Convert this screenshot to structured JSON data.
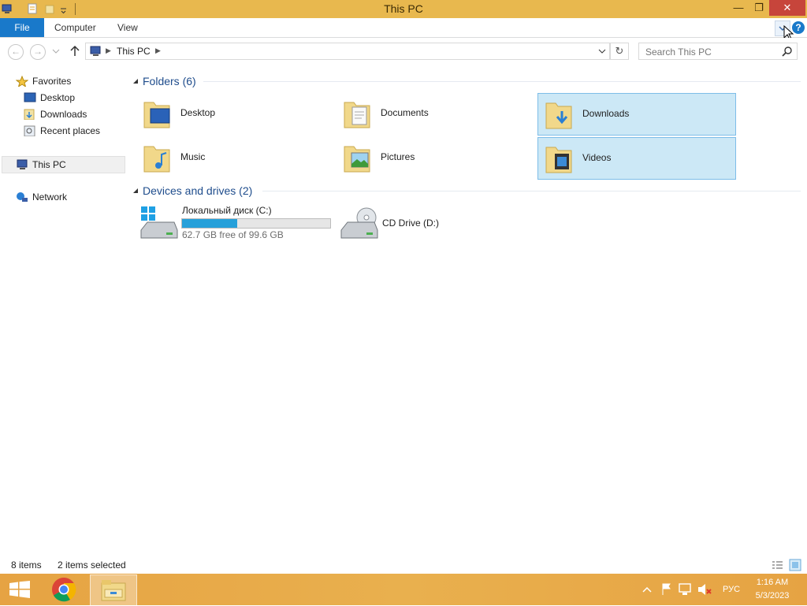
{
  "window": {
    "title": "This PC"
  },
  "ribbon": {
    "tabs": [
      "File",
      "Computer",
      "View"
    ]
  },
  "address": {
    "crumbs": [
      "This PC"
    ]
  },
  "search": {
    "placeholder": "Search This PC"
  },
  "navpane": {
    "favorites": "Favorites",
    "fav_items": [
      "Desktop",
      "Downloads",
      "Recent places"
    ],
    "thispc": "This PC",
    "network": "Network"
  },
  "content": {
    "folders_header": "Folders (6)",
    "folders": [
      {
        "name": "Desktop",
        "selected": false
      },
      {
        "name": "Documents",
        "selected": false
      },
      {
        "name": "Downloads",
        "selected": true
      },
      {
        "name": "Music",
        "selected": false
      },
      {
        "name": "Pictures",
        "selected": false
      },
      {
        "name": "Videos",
        "selected": true
      }
    ],
    "drives_header": "Devices and drives (2)",
    "drives": [
      {
        "name": "Локальный диск (C:)",
        "free": "62.7 GB free of 99.6 GB",
        "used_fraction": 0.37
      },
      {
        "name": "CD Drive (D:)"
      }
    ]
  },
  "status": {
    "count": "8 items",
    "selection": "2 items selected"
  },
  "taskbar": {
    "lang": "РУС",
    "time": "1:16 AM",
    "date": "5/3/2023"
  },
  "colors": {
    "accent": "#1979ca",
    "titlebar": "#e8b84e",
    "selection": "#cce8f6",
    "close": "#c7453b"
  }
}
